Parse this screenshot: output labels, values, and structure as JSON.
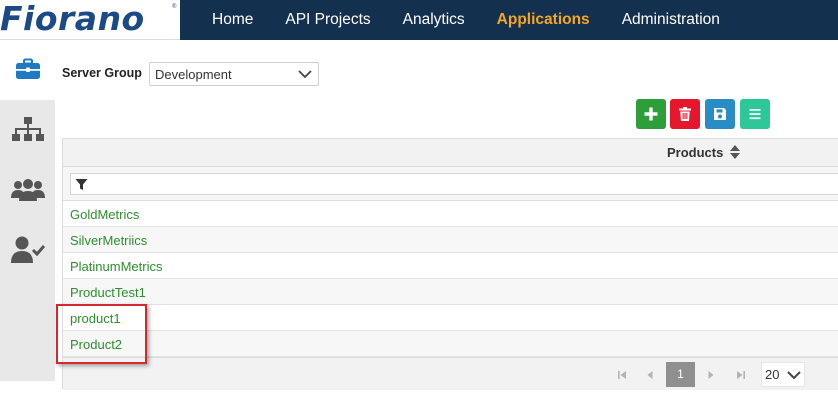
{
  "brand": {
    "logo_text": "Fiorano",
    "logo_mark": "®"
  },
  "nav": {
    "items": [
      {
        "label": "Home",
        "active": false
      },
      {
        "label": "API Projects",
        "active": false
      },
      {
        "label": "Analytics",
        "active": false
      },
      {
        "label": "Applications",
        "active": true
      },
      {
        "label": "Administration",
        "active": false
      }
    ],
    "active_color": "#f5a623"
  },
  "sidebar": {
    "icons": [
      "briefcase-icon",
      "sitemap-icon",
      "users-icon",
      "user-check-icon"
    ],
    "active_index": 0,
    "active_color": "#1f7ac4"
  },
  "server_group": {
    "label": "Server Group",
    "value": "Development"
  },
  "actions": {
    "add_color": "#2e9e3b",
    "delete_color": "#e5172d",
    "save_color": "#2a8cc4",
    "menu_color": "#2ec79a"
  },
  "grid": {
    "column_header": "Products",
    "filter_value": "",
    "rows": [
      "GoldMetrics",
      "SilverMetriics",
      "PlatinumMetrics",
      "ProductTest1",
      "product1",
      "Product2"
    ],
    "link_color": "#2d8f2d"
  },
  "pager": {
    "current_page": "1",
    "page_size": "20"
  },
  "annotation": {
    "highlight_color": "#d4282e",
    "highlighted_rows": [
      "product1",
      "Product2"
    ]
  }
}
